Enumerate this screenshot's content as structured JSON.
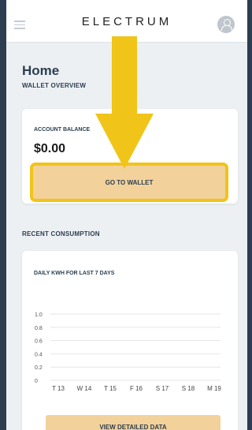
{
  "header": {
    "logo": "ELECTRUM"
  },
  "home": {
    "title": "Home",
    "wallet_overview_label": "WALLET OVERVIEW"
  },
  "wallet_card": {
    "account_balance_label": "ACCOUNT BALANCE",
    "balance": "$0.00",
    "go_to_wallet": "GO TO WALLET"
  },
  "consumption": {
    "section_label": "RECENT CONSUMPTION",
    "chart_title": "DAILY KWH FOR LAST 7 DAYS",
    "view_detailed": "VIEW DETAILED DATA"
  },
  "colors": {
    "accent_button": "#f3d19a",
    "highlight": "#f0c419",
    "frame": "#2c3e50"
  },
  "chart_data": {
    "type": "line",
    "title": "DAILY KWH FOR LAST 7 DAYS",
    "categories": [
      "T 13",
      "W 14",
      "T 15",
      "F 16",
      "S 17",
      "S 18",
      "M 19"
    ],
    "y_ticks": [
      "1.0",
      "0.8",
      "0.6",
      "0.4",
      "0.2",
      "0"
    ],
    "ylim": [
      0,
      1
    ],
    "series": [],
    "grid": true
  }
}
